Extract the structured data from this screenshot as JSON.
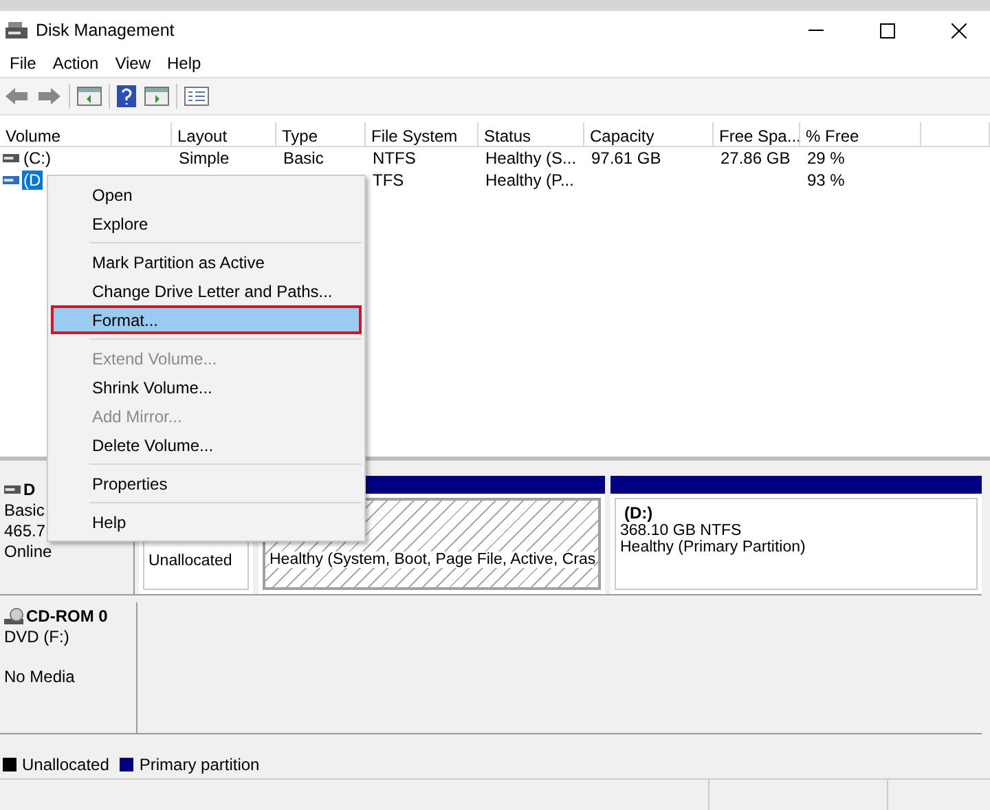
{
  "window": {
    "title": "Disk Management"
  },
  "menu_bar": [
    "File",
    "Action",
    "View",
    "Help"
  ],
  "table": {
    "columns": [
      "Volume",
      "Layout",
      "Type",
      "File System",
      "Status",
      "Capacity",
      "Free Spa...",
      "% Free"
    ],
    "rows": [
      {
        "selected": false,
        "cells": [
          "(C:)",
          "Simple",
          "Basic",
          "NTFS",
          "Healthy (S...",
          "97.61 GB",
          "27.86 GB",
          "29 %"
        ]
      },
      {
        "selected": true,
        "cells": [
          "(D",
          "",
          "",
          "TFS",
          "Healthy (P...",
          "",
          "",
          "93 %"
        ]
      }
    ]
  },
  "disks": [
    {
      "kind": "disk",
      "name": "D",
      "lines": [
        "Basic",
        "465.7",
        "Online"
      ],
      "partitions": [
        {
          "kind": "unallocated",
          "selected": false,
          "lines": [
            "Unallocated"
          ]
        },
        {
          "kind": "primary",
          "selected": true,
          "lines": [
            "Healthy (System, Boot, Page File, Active, Cras"
          ]
        },
        {
          "kind": "primary",
          "selected": false,
          "title": "(D:)",
          "lines": [
            "368.10 GB NTFS",
            "Healthy (Primary Partition)"
          ]
        }
      ]
    },
    {
      "kind": "cdrom",
      "name": "CD-ROM 0",
      "lines": [
        "DVD (F:)",
        "No Media"
      ]
    }
  ],
  "legend": [
    {
      "label": "Unallocated",
      "color": "#000000"
    },
    {
      "label": "Primary partition",
      "color": "#000080"
    }
  ],
  "context_menu": [
    {
      "kind": "item",
      "label": "Open",
      "disabled": false,
      "selected": false
    },
    {
      "kind": "item",
      "label": "Explore",
      "disabled": false,
      "selected": false
    },
    {
      "kind": "separator"
    },
    {
      "kind": "item",
      "label": "Mark Partition as Active",
      "disabled": false,
      "selected": false
    },
    {
      "kind": "item",
      "label": "Change Drive Letter and Paths...",
      "disabled": false,
      "selected": false
    },
    {
      "kind": "item",
      "label": "Format...",
      "disabled": false,
      "selected": true
    },
    {
      "kind": "separator"
    },
    {
      "kind": "item",
      "label": "Extend Volume...",
      "disabled": true,
      "selected": false
    },
    {
      "kind": "item",
      "label": "Shrink Volume...",
      "disabled": false,
      "selected": false
    },
    {
      "kind": "item",
      "label": "Add Mirror...",
      "disabled": true,
      "selected": false
    },
    {
      "kind": "item",
      "label": "Delete Volume...",
      "disabled": false,
      "selected": false
    },
    {
      "kind": "separator"
    },
    {
      "kind": "item",
      "label": "Properties",
      "disabled": false,
      "selected": false
    },
    {
      "kind": "separator"
    },
    {
      "kind": "item",
      "label": "Help",
      "disabled": false,
      "selected": false
    }
  ]
}
